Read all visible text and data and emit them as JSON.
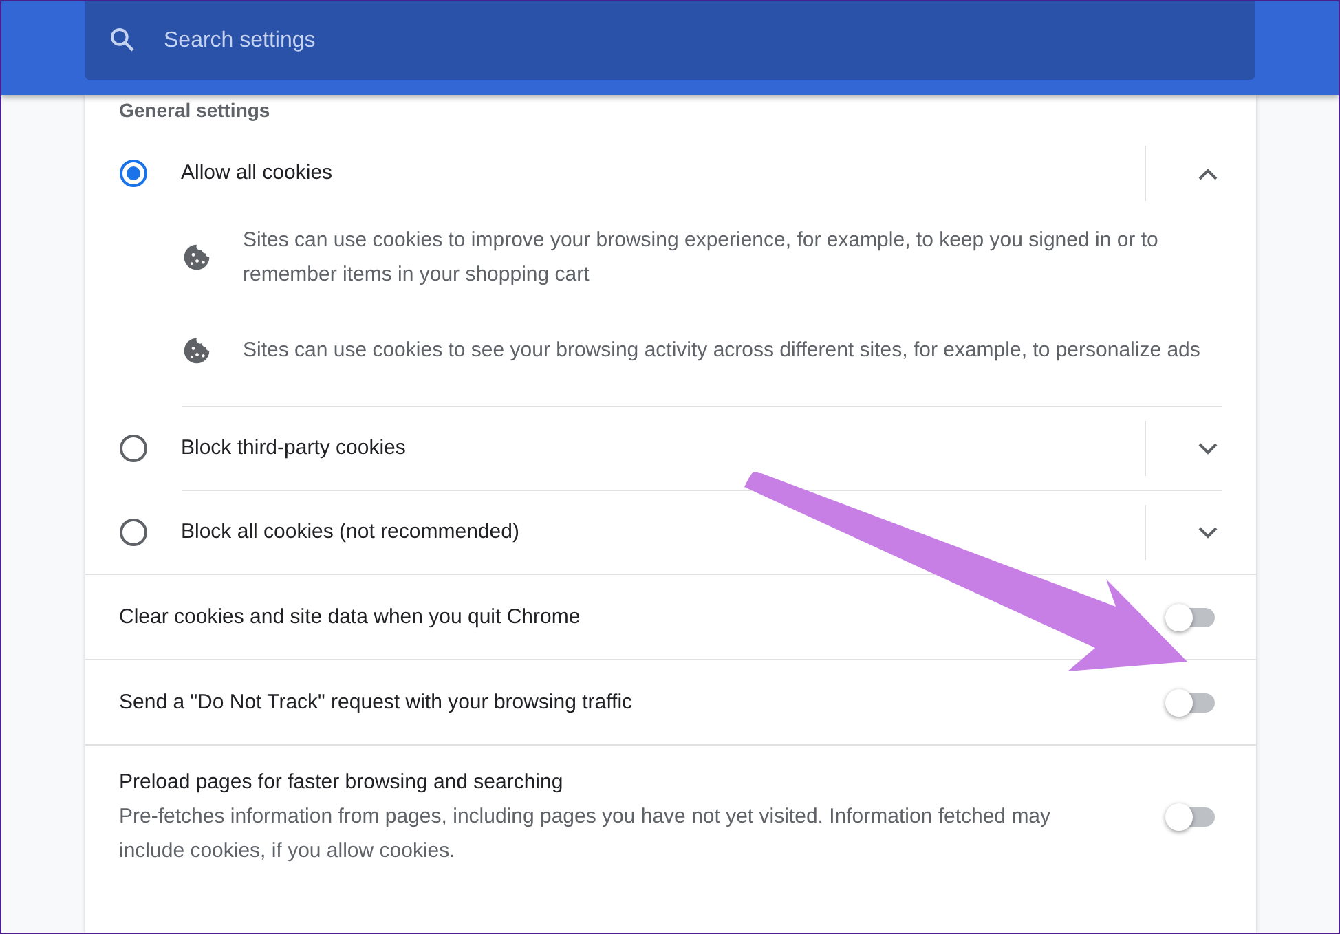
{
  "search": {
    "placeholder": "Search settings"
  },
  "section_title": "General settings",
  "cookie_options": [
    {
      "label": "Allow all cookies",
      "selected": true,
      "expanded": true,
      "details": [
        "Sites can use cookies to improve your browsing experience, for example, to keep you signed in or to remember items in your shopping cart",
        "Sites can use cookies to see your browsing activity across different sites, for example, to personalize ads"
      ]
    },
    {
      "label": "Block third-party cookies",
      "selected": false,
      "expanded": false
    },
    {
      "label": "Block all cookies (not recommended)",
      "selected": false,
      "expanded": false
    }
  ],
  "toggles": [
    {
      "label": "Clear cookies and site data when you quit Chrome",
      "on": false
    },
    {
      "label": "Send a \"Do Not Track\" request with your browsing traffic",
      "on": false
    },
    {
      "label": "Preload pages for faster browsing and searching",
      "description": "Pre-fetches information from pages, including pages you have not yet visited. Information fetched may include cookies, if you allow cookies.",
      "on": false
    }
  ]
}
